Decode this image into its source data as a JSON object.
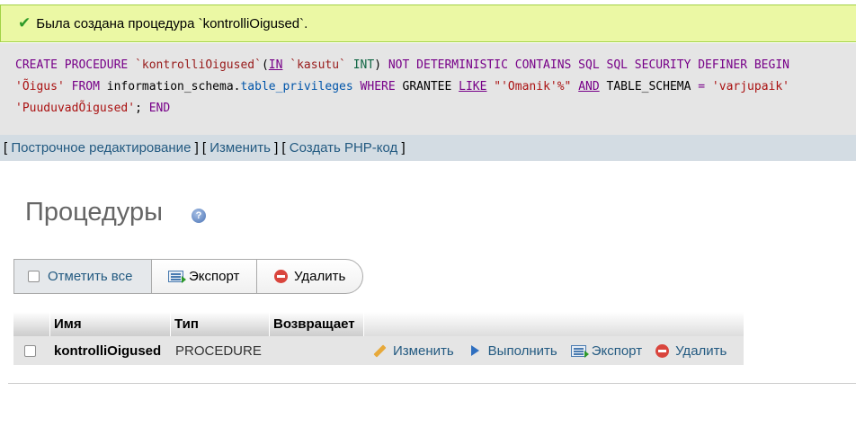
{
  "message": {
    "icon": "check-icon",
    "text": "Была создана процедура `kontrolliOigused`."
  },
  "sql": {
    "line1": {
      "a": "CREATE PROCEDURE ",
      "b": "`kontrolliOigused`",
      "c": "(",
      "d": "IN",
      "e": " `kasutu` ",
      "f": "INT",
      "g": ") ",
      "h": "NOT DETERMINISTIC CONTAINS SQL SQL SECURITY DEFINER BEGIN"
    },
    "line2": {
      "a": "'Õigus'",
      "b": " FROM ",
      "c": "information_schema",
      "d": ".",
      "e": "table_privileges",
      "f": " WHERE ",
      "g": "GRANTEE ",
      "h": "LIKE",
      "i": " \"'Omanik'%\" ",
      "j": "AND",
      "k": " TABLE_SCHEMA ",
      "l": "=",
      "m": " 'varjupaik'"
    },
    "line3": {
      "a": "'PuuduvadÕigused'",
      "b": "; ",
      "c": "END"
    }
  },
  "sql_tools": {
    "inline_edit": "Построчное редактирование",
    "edit": "Изменить",
    "create_php": "Создать PHP-код"
  },
  "section": {
    "title": "Процедуры",
    "help_icon": "help-icon"
  },
  "bulk": {
    "check_all": "Отметить все",
    "export": "Экспорт",
    "delete": "Удалить"
  },
  "table": {
    "headers": [
      "Имя",
      "Тип",
      "Возвращает"
    ],
    "rows": [
      {
        "name": "kontrolliOigused",
        "type": "PROCEDURE",
        "returns": "",
        "actions": [
          "Изменить",
          "Выполнить",
          "Экспорт",
          "Удалить"
        ]
      }
    ]
  },
  "colors": {
    "success_bg": "#ebf8a4",
    "link": "#235a81",
    "keyword": "#770088",
    "string": "#aa1111"
  }
}
